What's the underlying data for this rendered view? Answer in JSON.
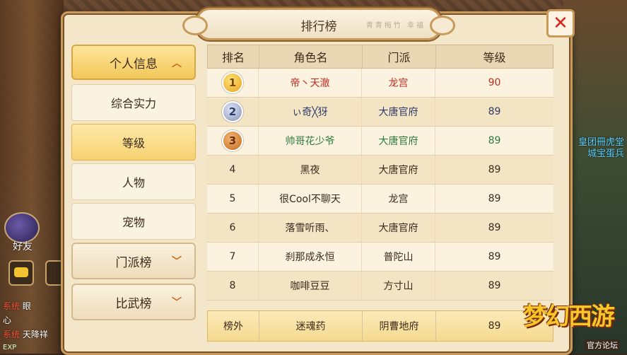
{
  "panel": {
    "title": "排行榜",
    "title_faint": "青青梅竹 幸福"
  },
  "menu": {
    "header": "个人信息",
    "items": [
      "综合实力",
      "等级",
      "人物",
      "宠物"
    ],
    "active_index": 1,
    "groups": [
      "门派榜",
      "比武榜"
    ]
  },
  "table": {
    "headers": [
      "排名",
      "角色名",
      "门派",
      "等级"
    ],
    "rows": [
      {
        "rank": "1",
        "name": "帝丶天澈",
        "school": "龙宫",
        "level": "90",
        "color": "#c42a22"
      },
      {
        "rank": "2",
        "name": "ぃ奇╳犽",
        "school": "大唐官府",
        "level": "89",
        "color": "#2d3a6a"
      },
      {
        "rank": "3",
        "name": "帅哥花少爷",
        "school": "大唐官府",
        "level": "89",
        "color": "#2d7a3e"
      },
      {
        "rank": "4",
        "name": "黑夜",
        "school": "大唐官府",
        "level": "89"
      },
      {
        "rank": "5",
        "name": "很Cool不聊天",
        "school": "龙宫",
        "level": "89"
      },
      {
        "rank": "6",
        "name": "落雪听雨、",
        "school": "大唐官府",
        "level": "89"
      },
      {
        "rank": "7",
        "name": "刹那成永恒",
        "school": "普陀山",
        "level": "89"
      },
      {
        "rank": "8",
        "name": "咖啡豆豆",
        "school": "方寸山",
        "level": "89"
      }
    ],
    "self_row": {
      "rank": "榜外",
      "name": "迷魂药",
      "school": "阴曹地府",
      "level": "89"
    }
  },
  "hud": {
    "friend_label": "好友",
    "sys_tag": "系统",
    "sys_lines": [
      "眼",
      "心",
      "天降祥"
    ],
    "exp": "EXP",
    "npc_name_1": "皇团冊虎堂",
    "npc_name_2": "城宝蛋兵"
  },
  "logo": {
    "text": "梦幻西游",
    "sub": "官方论坛"
  },
  "colors": {
    "accent_gold": "#f2c75a",
    "panel_bg": "#f3e6c9",
    "close_red": "#d8261d"
  }
}
